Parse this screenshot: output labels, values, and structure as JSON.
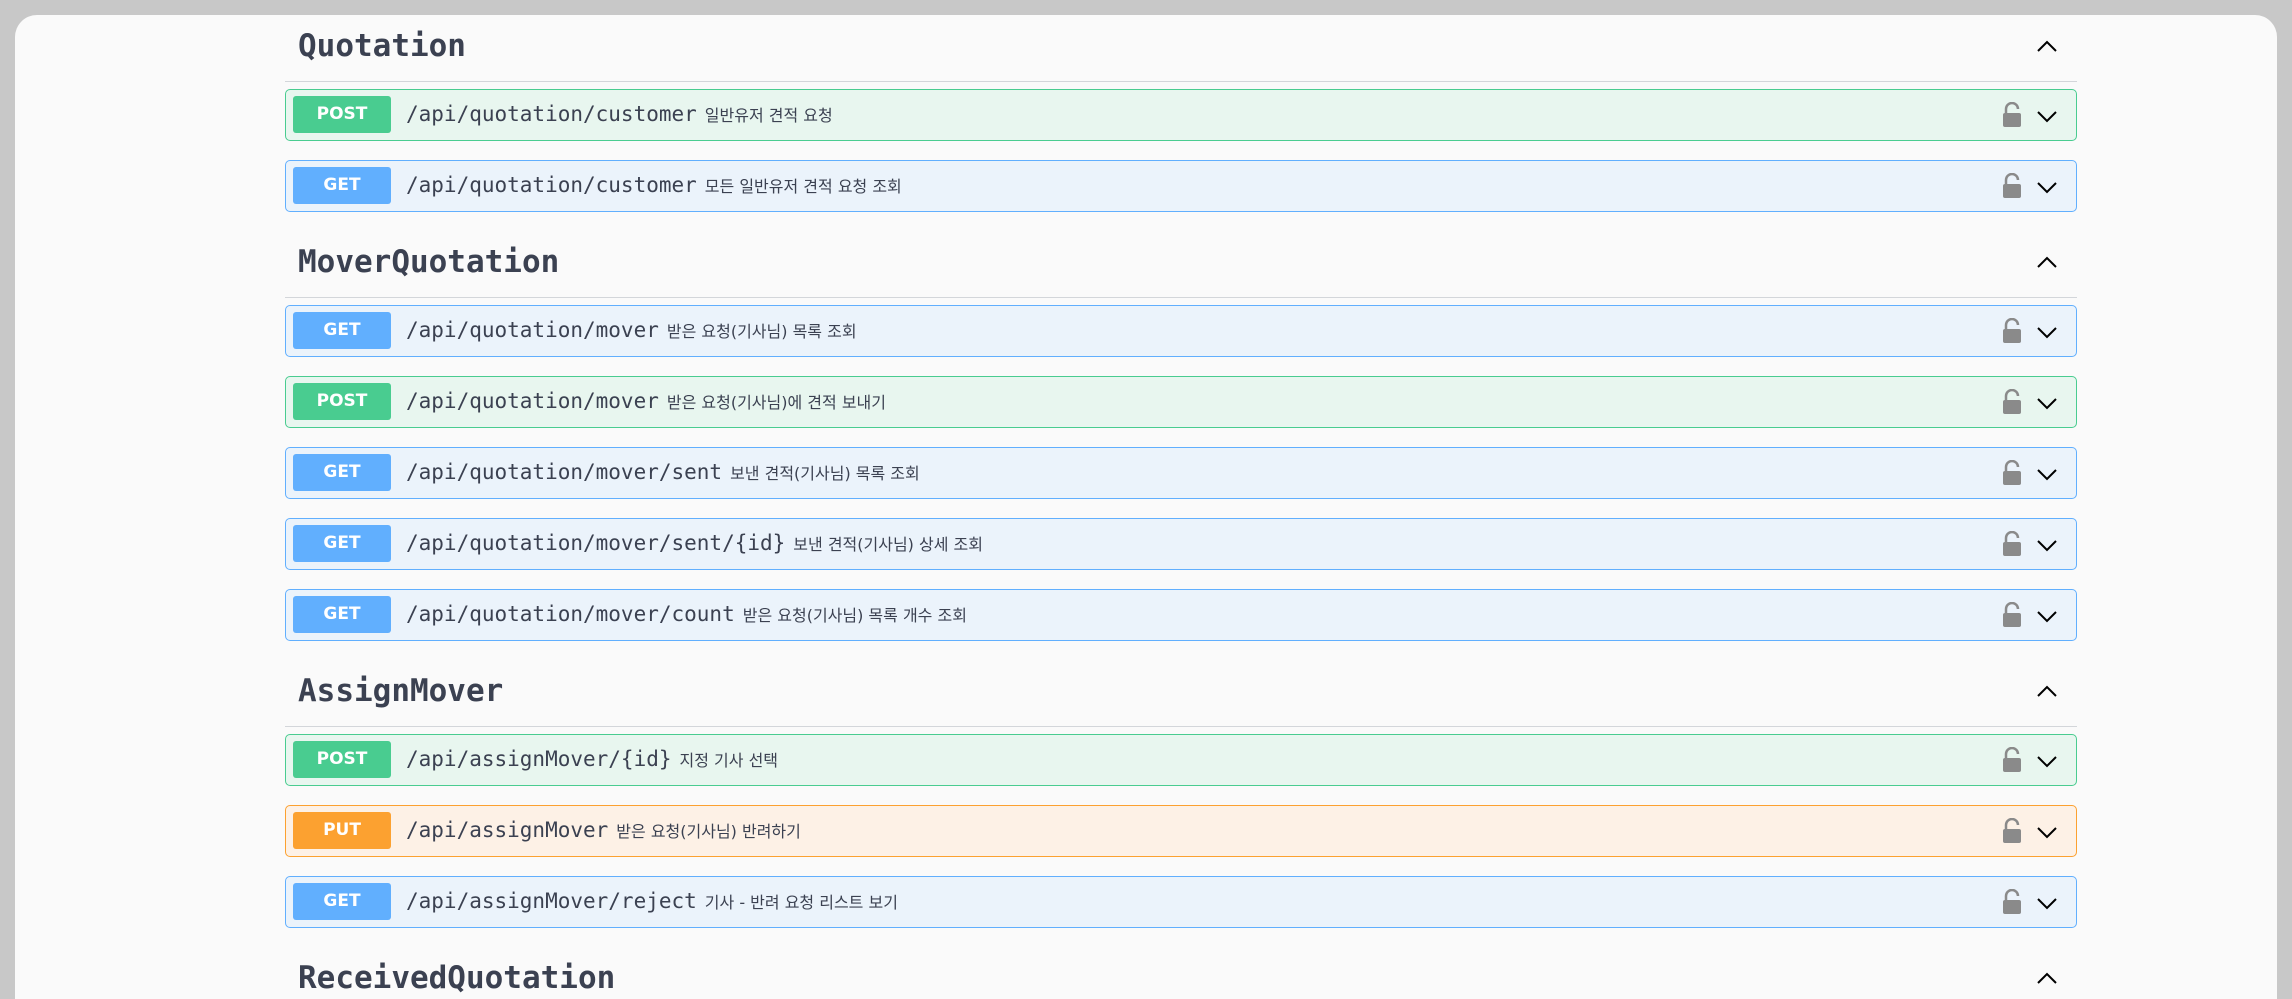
{
  "sections": [
    {
      "title": "Quotation",
      "operations": [
        {
          "method": "POST",
          "path": "/api/quotation/customer",
          "summary": "일반유저 견적 요청"
        },
        {
          "method": "GET",
          "path": "/api/quotation/customer",
          "summary": "모든 일반유저 견적 요청 조회"
        }
      ]
    },
    {
      "title": "MoverQuotation",
      "operations": [
        {
          "method": "GET",
          "path": "/api/quotation/mover",
          "summary": "받은 요청(기사님) 목록 조회"
        },
        {
          "method": "POST",
          "path": "/api/quotation/mover",
          "summary": "받은 요청(기사님)에 견적 보내기"
        },
        {
          "method": "GET",
          "path": "/api/quotation/mover/sent",
          "summary": "보낸 견적(기사님) 목록 조회"
        },
        {
          "method": "GET",
          "path": "/api/quotation/mover/sent/{id}",
          "summary": "보낸 견적(기사님) 상세 조회"
        },
        {
          "method": "GET",
          "path": "/api/quotation/mover/count",
          "summary": "받은 요청(기사님) 목록 개수 조회"
        }
      ]
    },
    {
      "title": "AssignMover",
      "operations": [
        {
          "method": "POST",
          "path": "/api/assignMover/{id}",
          "summary": "지정 기사 선택"
        },
        {
          "method": "PUT",
          "path": "/api/assignMover",
          "summary": "받은 요청(기사님) 반려하기"
        },
        {
          "method": "GET",
          "path": "/api/assignMover/reject",
          "summary": "기사 - 반려 요청 리스트 보기"
        }
      ]
    },
    {
      "title": "ReceivedQuotation",
      "operations": []
    }
  ],
  "colors": {
    "post": "#49cc90",
    "get": "#61affe",
    "put": "#fca130",
    "text": "#3b4151"
  },
  "icons": {
    "collapse": "chevron-up-icon",
    "expand": "chevron-down-icon",
    "auth": "lock-icon"
  }
}
